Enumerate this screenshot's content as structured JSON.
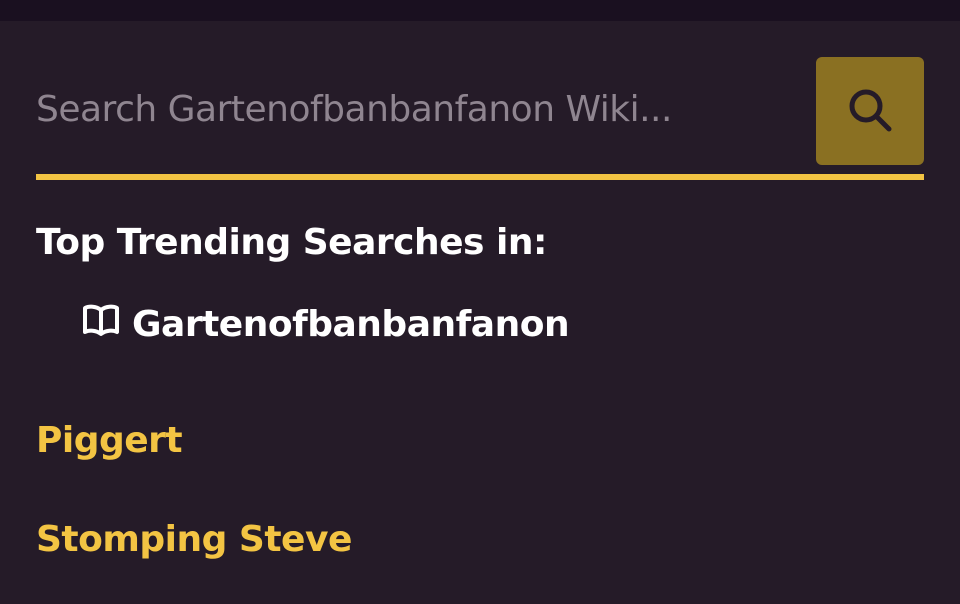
{
  "search": {
    "placeholder": "Search Gartenofbanbanfanon Wiki...",
    "value": "",
    "button_icon": "search-icon"
  },
  "trending": {
    "heading": "Top Trending Searches in:",
    "community_icon": "book-icon",
    "community_name": "Gartenofbanbanfanon",
    "items": [
      {
        "label": "Piggert"
      },
      {
        "label": "Stomping Steve"
      }
    ]
  },
  "colors": {
    "background": "#251b28",
    "accent": "#f3c443",
    "button": "#8a7022",
    "placeholder": "#8f8590"
  }
}
